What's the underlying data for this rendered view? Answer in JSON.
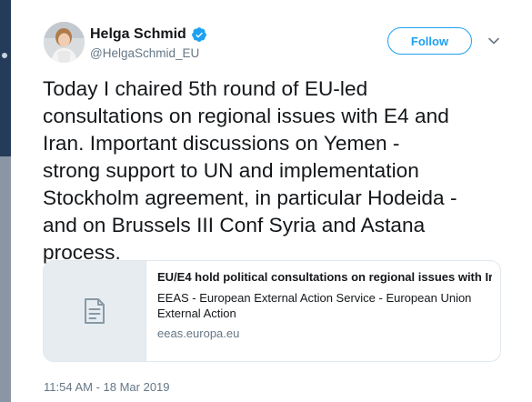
{
  "author": {
    "display_name": "Helga Schmid",
    "handle": "@HelgaSchmid_EU",
    "verified": true
  },
  "actions": {
    "follow_label": "Follow"
  },
  "tweet": {
    "text_lines": [
      "Today I chaired 5th round of EU-led",
      "consultations on regional issues with E4 and",
      "Iran. Important discussions on Yemen -",
      "strong support to UN and implementation",
      "Stockholm agreement, in particular Hodeida -",
      "and on Brussels III Conf Syria and Astana",
      "process."
    ],
    "timestamp": "11:54 AM - 18 Mar 2019"
  },
  "card": {
    "title": "EU/E4 hold political consultations on regional issues with Ir...",
    "description": "EEAS - European External Action Service - European Union External Action",
    "domain": "eeas.europa.eu",
    "thumbnail_icon": "document-icon"
  },
  "colors": {
    "accent": "#1da1f2",
    "text": "#14171a",
    "muted": "#657786",
    "card_border": "#e1e8ed",
    "thumb_bg": "#e6ecf0"
  }
}
